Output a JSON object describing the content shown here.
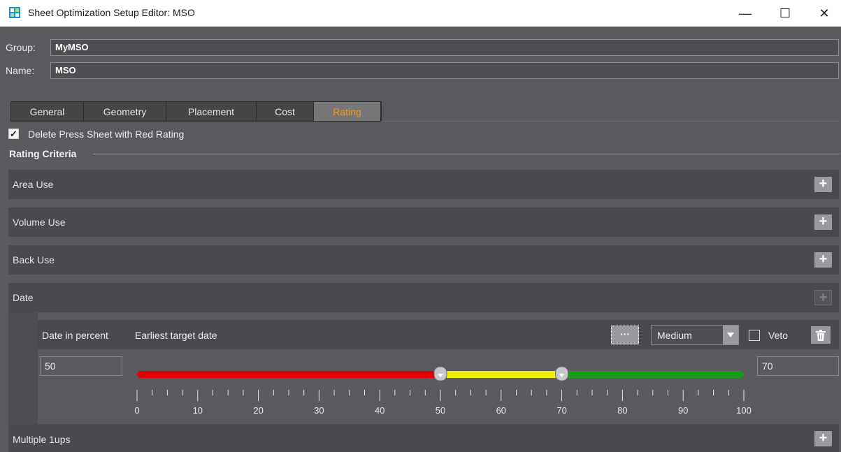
{
  "window": {
    "title": "Sheet Optimization Setup Editor: MSO",
    "minimize_glyph": "—",
    "maximize_glyph": "☐",
    "close_glyph": "✕"
  },
  "form": {
    "group_label": "Group:",
    "group_value": "MyMSO",
    "name_label": "Name:",
    "name_value": "MSO"
  },
  "tabs": [
    {
      "label": "General"
    },
    {
      "label": "Geometry"
    },
    {
      "label": "Placement"
    },
    {
      "label": "Cost"
    },
    {
      "label": "Rating",
      "active": true
    }
  ],
  "delete_red_rating": {
    "checked": true,
    "label": "Delete Press Sheet with Red Rating"
  },
  "rating_criteria": {
    "title": "Rating Criteria",
    "rows": [
      {
        "label": "Area Use",
        "button": "+"
      },
      {
        "label": "Volume Use",
        "button": "+"
      },
      {
        "label": "Back Use",
        "button": "+"
      },
      {
        "label": "Date",
        "button": "+",
        "button_disabled": true
      }
    ],
    "date_detail": {
      "mode_label": "Date in percent",
      "target_label": "Earliest target date",
      "dots_label": "···",
      "weight_value": "Medium",
      "veto_label": "Veto",
      "veto_checked": false,
      "lower_value": "50",
      "upper_value": "70",
      "slider": {
        "min": 0,
        "max": 100,
        "red_to": 50,
        "yellow_to": 70,
        "tick_labels": [
          "0",
          "10",
          "20",
          "30",
          "40",
          "50",
          "60",
          "70",
          "80",
          "90",
          "100"
        ],
        "colors": {
          "red": "#e00000",
          "yellow": "#f0f000",
          "green": "#1a9a1a"
        }
      }
    },
    "last_row": {
      "label": "Multiple 1ups",
      "button": "+"
    }
  },
  "colors": {
    "accent": "#f29624",
    "panel": "#5a5a5e",
    "row": "#4a4a4e"
  }
}
